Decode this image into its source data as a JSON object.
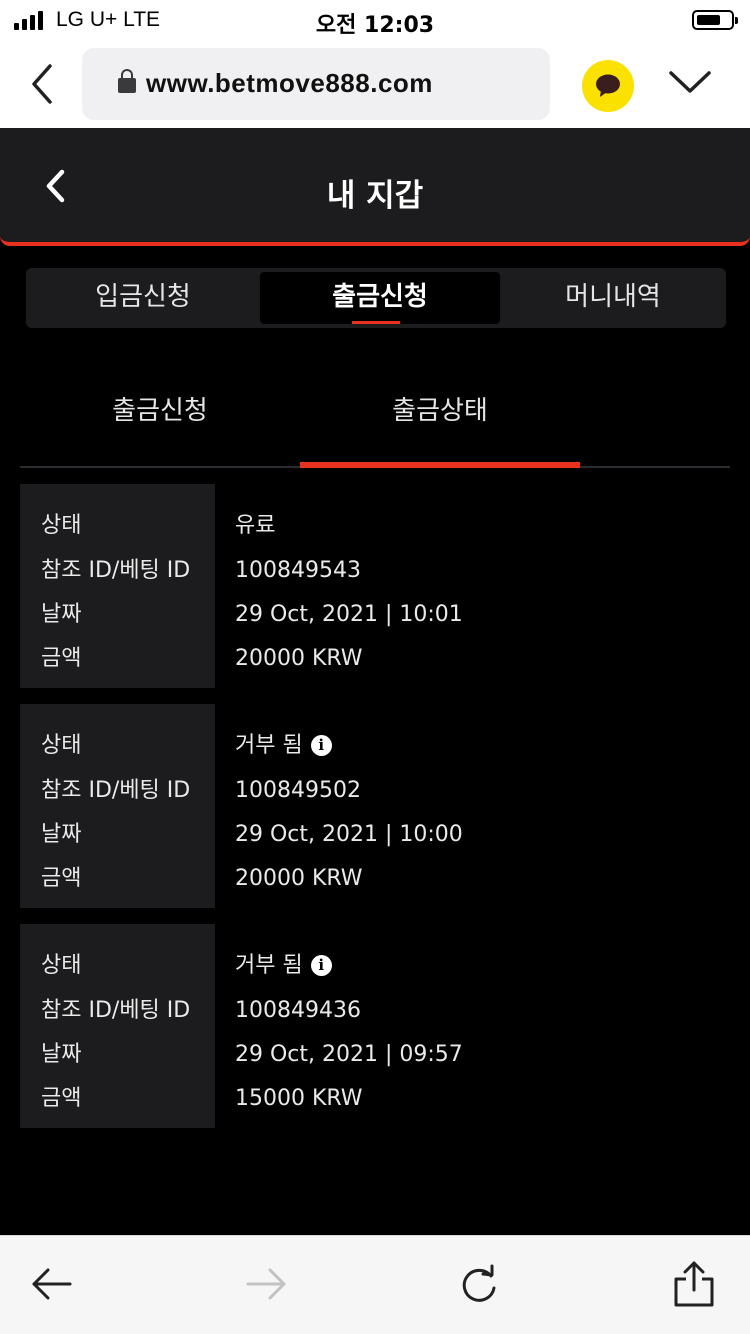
{
  "status_bar": {
    "carrier": "LG U+  LTE",
    "time": "오전 12:03"
  },
  "browser": {
    "url": "www.betmove888.com",
    "icons": [
      "back-icon",
      "lock-icon",
      "kakaotalk-icon",
      "chevron-down-icon"
    ]
  },
  "header": {
    "title": "내 지갑"
  },
  "tabs": [
    {
      "label": "입금신청"
    },
    {
      "label": "출금신청"
    },
    {
      "label": "머니내역"
    }
  ],
  "subtabs": [
    {
      "label": "출금신청"
    },
    {
      "label": "출금상태"
    }
  ],
  "field_labels": {
    "status": "상태",
    "ref": "참조 ID/베팅 ID",
    "date": "날짜",
    "amount": "금액"
  },
  "records": [
    {
      "status": "유료",
      "ref": "100849543",
      "date": "29 Oct, 2021 | 10:01",
      "amount": "20000 KRW"
    },
    {
      "status": "거부 됨",
      "ref": "100849502",
      "date": "29 Oct, 2021 | 10:00",
      "amount": "20000 KRW"
    },
    {
      "status": "거부 됨",
      "ref": "100849436",
      "date": "29 Oct, 2021 | 09:57",
      "amount": "15000 KRW"
    }
  ],
  "info_icon_glyph": "i",
  "colors": {
    "accent": "#e8311e",
    "background": "#000000",
    "panel": "#1c1c1e",
    "kakao": "#fae100"
  }
}
